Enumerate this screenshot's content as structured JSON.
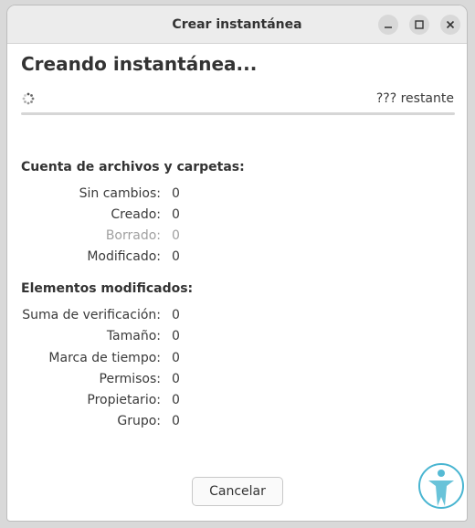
{
  "window": {
    "title": "Crear instantánea",
    "controls": [
      "minimize",
      "maximize",
      "close"
    ]
  },
  "heading": "Creando instantánea...",
  "progress": {
    "remaining_text": "??? restante",
    "fraction": 0.0
  },
  "files_section": {
    "title": "Cuenta de archivos y carpetas:",
    "rows": [
      {
        "label": "Sin cambios:",
        "value": "0",
        "dim": false
      },
      {
        "label": "Creado:",
        "value": "0",
        "dim": false
      },
      {
        "label": "Borrado:",
        "value": "0",
        "dim": true
      },
      {
        "label": "Modificado:",
        "value": "0",
        "dim": false
      }
    ]
  },
  "modified_section": {
    "title": "Elementos modificados:",
    "rows": [
      {
        "label": "Suma de verificación:",
        "value": "0"
      },
      {
        "label": "Tamaño:",
        "value": "0"
      },
      {
        "label": "Marca de tiempo:",
        "value": "0"
      },
      {
        "label": "Permisos:",
        "value": "0"
      },
      {
        "label": "Propietario:",
        "value": "0"
      },
      {
        "label": "Grupo:",
        "value": "0"
      }
    ]
  },
  "buttons": {
    "cancel": "Cancelar"
  },
  "colors": {
    "accent": "#3584e4",
    "watermark": "#2aa9c9"
  }
}
